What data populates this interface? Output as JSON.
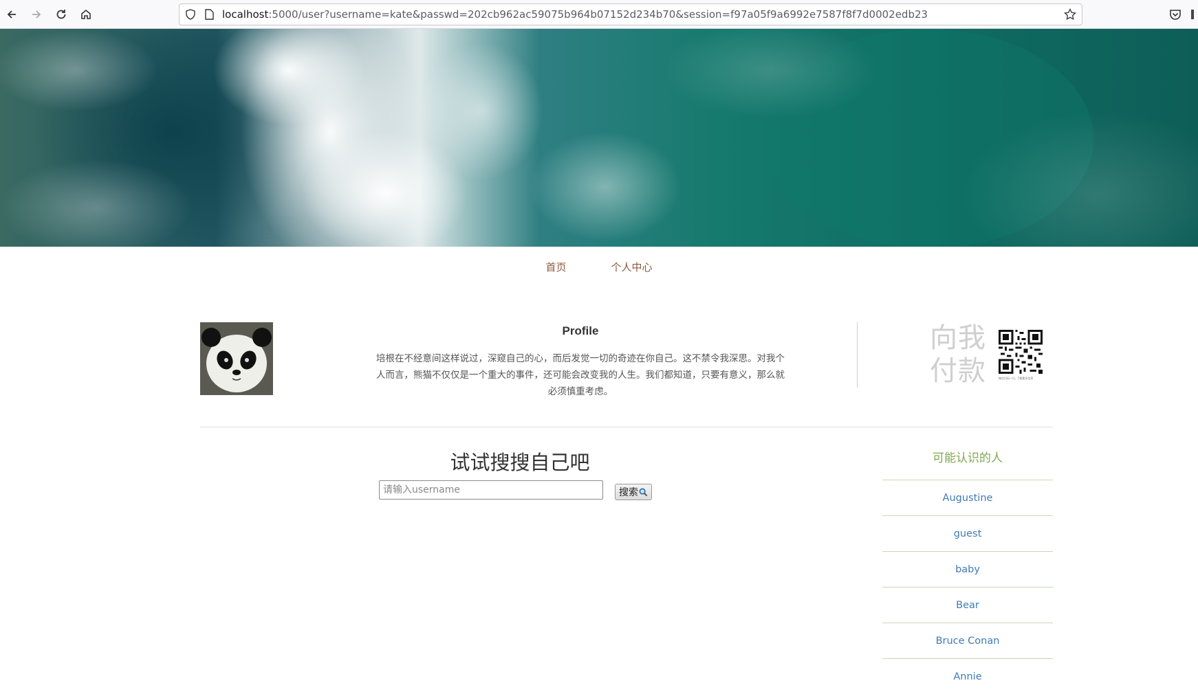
{
  "browser": {
    "url_host": "localhost",
    "url_rest": ":5000/user?username=kate&passwd=202cb962ac59075b964b07152d234b70&session=f97a05f9a6992e7587f8f7d0002edb23"
  },
  "nav": {
    "items": [
      {
        "label": "首页"
      },
      {
        "label": "个人中心"
      }
    ]
  },
  "profile": {
    "title": "Profile",
    "text": "培根在不经意间这样说过，深窥自己的心，而后发觉一切的奇迹在你自己。这不禁令我深思。对我个人而言，熊猫不仅仅是一个重大的事件，还可能会改变我的人生。我们都知道，只要有意义，那么就必须慎重考虑。"
  },
  "payment": {
    "line1": "向我",
    "line2": "付款",
    "qr_caption": "微信扫码一扫, 了解更多信息"
  },
  "search": {
    "title": "试试搜搜自己吧",
    "placeholder": "请输入username",
    "button_label": "搜索"
  },
  "people": {
    "title": "可能认识的人",
    "items": [
      {
        "name": "Augustine"
      },
      {
        "name": "guest"
      },
      {
        "name": "baby"
      },
      {
        "name": "Bear"
      },
      {
        "name": "Bruce Conan"
      },
      {
        "name": "Annie"
      }
    ]
  },
  "colors": {
    "nav_link": "#8a5a3c",
    "people_title": "#7fa84f",
    "people_link": "#3f7bb5"
  }
}
